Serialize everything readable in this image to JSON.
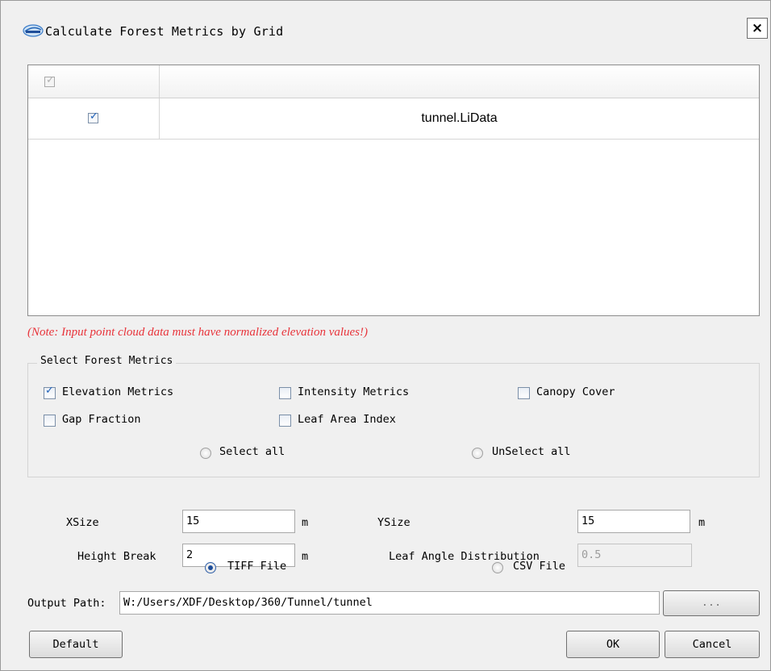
{
  "window": {
    "title": "Calculate Forest Metrics by Grid",
    "close_label": "×",
    "icon": "lidar-logo-icon"
  },
  "file_table": {
    "header_checked": true,
    "rows": [
      {
        "checked": true,
        "name": "tunnel.LiData"
      }
    ]
  },
  "note": "(Note: Input point cloud data must have normalized elevation values!)",
  "metrics_group": {
    "title": "Select Forest Metrics",
    "options": [
      {
        "label": "Elevation Metrics",
        "checked": true
      },
      {
        "label": "Intensity Metrics",
        "checked": false
      },
      {
        "label": "Canopy Cover",
        "checked": false
      },
      {
        "label": "Gap Fraction",
        "checked": false
      },
      {
        "label": "Leaf Area Index",
        "checked": false
      }
    ],
    "select_all_label": "Select all",
    "unselect_all_label": "UnSelect all",
    "select_all_selected": false,
    "unselect_all_selected": false
  },
  "params": {
    "xsize_label": "XSize",
    "xsize_value": "15",
    "xsize_unit": "m",
    "ysize_label": "YSize",
    "ysize_value": "15",
    "ysize_unit": "m",
    "height_break_label": "Height Break",
    "height_break_value": "2",
    "height_break_unit": "m",
    "leaf_angle_label": "Leaf Angle Distribution",
    "leaf_angle_value": "0.5"
  },
  "output_format": {
    "tiff_label": "TIFF File",
    "csv_label": "CSV File",
    "selected": "tiff"
  },
  "output": {
    "label": "Output Path:",
    "value": "W:/Users/XDF/Desktop/360/Tunnel/tunnel",
    "browse_label": "..."
  },
  "buttons": {
    "default_label": "Default",
    "ok_label": "OK",
    "cancel_label": "Cancel"
  },
  "colors": {
    "note": "#e8333a",
    "check_accent": "#1c5fb8"
  }
}
